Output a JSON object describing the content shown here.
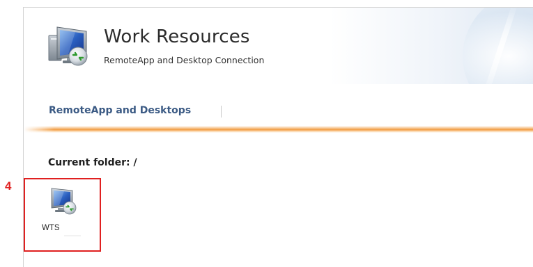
{
  "header": {
    "title": "Work Resources",
    "subtitle": "RemoteApp and Desktop Connection",
    "icon": "remote-desktop-monitor-icon"
  },
  "nav": {
    "tabs": [
      {
        "label": "RemoteApp and Desktops",
        "active": true
      }
    ]
  },
  "folder": {
    "current_label": "Current folder: /"
  },
  "resources": [
    {
      "label": "WTS",
      "icon": "remote-desktop-monitor-icon"
    }
  ],
  "annotation": {
    "number": "4",
    "color": "#e02020"
  },
  "colors": {
    "nav_link": "#3b5a84",
    "accent_bar": "#f29a3e"
  }
}
